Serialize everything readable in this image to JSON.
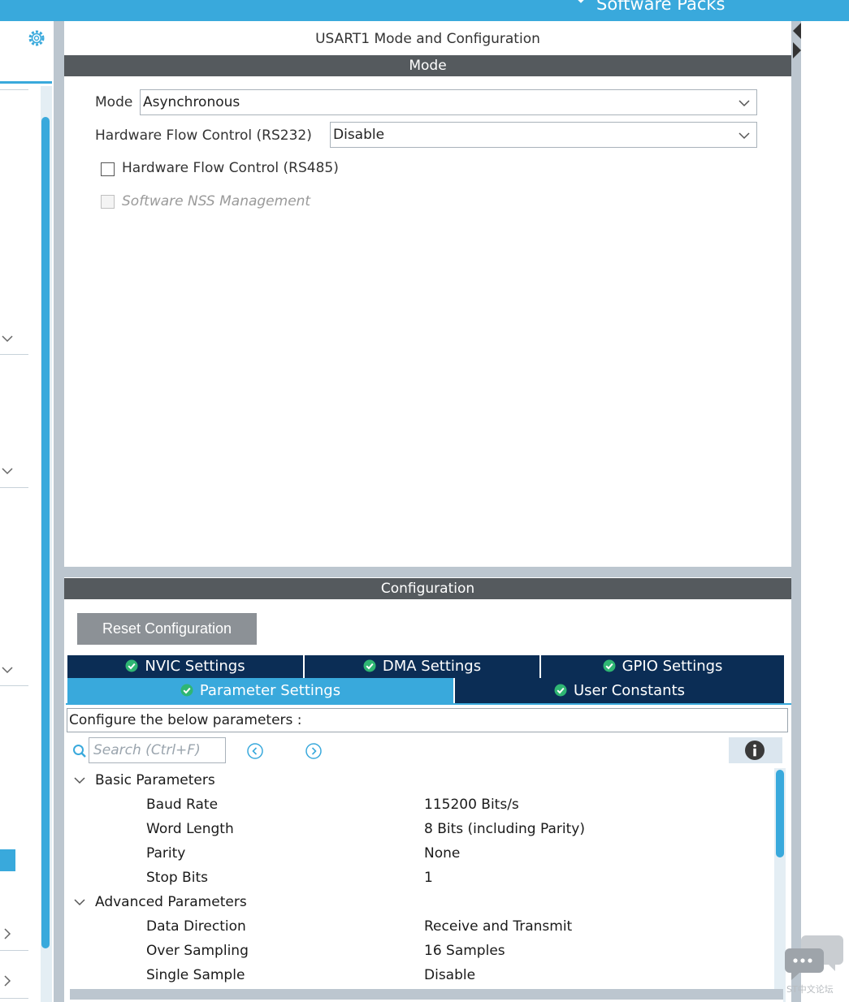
{
  "topbar": {
    "software_packs": "Software Packs"
  },
  "panel": {
    "title": "USART1 Mode and Configuration"
  },
  "mode": {
    "header": "Mode",
    "mode_label": "Mode",
    "mode_value": "Asynchronous",
    "hwfc_label": "Hardware Flow Control (RS232)",
    "hwfc_value": "Disable",
    "rs485_label": "Hardware Flow Control (RS485)",
    "nss_label": "Software NSS Management"
  },
  "config": {
    "header": "Configuration",
    "reset_label": "Reset Configuration",
    "tabs": {
      "nvic": "NVIC Settings",
      "dma": "DMA Settings",
      "gpio": "GPIO Settings",
      "parameter": "Parameter Settings",
      "user_constants": "User Constants"
    },
    "intro": "Configure the below parameters :",
    "search_placeholder": "Search (Ctrl+F)"
  },
  "tree": {
    "basic": {
      "title": "Basic Parameters",
      "items": [
        {
          "name": "Baud Rate",
          "value": "115200 Bits/s"
        },
        {
          "name": "Word Length",
          "value": "8 Bits (including Parity)"
        },
        {
          "name": "Parity",
          "value": "None"
        },
        {
          "name": "Stop Bits",
          "value": "1"
        }
      ]
    },
    "advanced": {
      "title": "Advanced Parameters",
      "items": [
        {
          "name": "Data Direction",
          "value": "Receive and Transmit"
        },
        {
          "name": "Over Sampling",
          "value": "16 Samples"
        },
        {
          "name": "Single Sample",
          "value": "Disable"
        }
      ]
    }
  },
  "watermark": {
    "text": "ST中文论坛"
  },
  "colors": {
    "accent": "#39a9dc",
    "tab_dark": "#0b2d55",
    "header_dark": "#555a5e",
    "check_green": "#2fb673"
  }
}
